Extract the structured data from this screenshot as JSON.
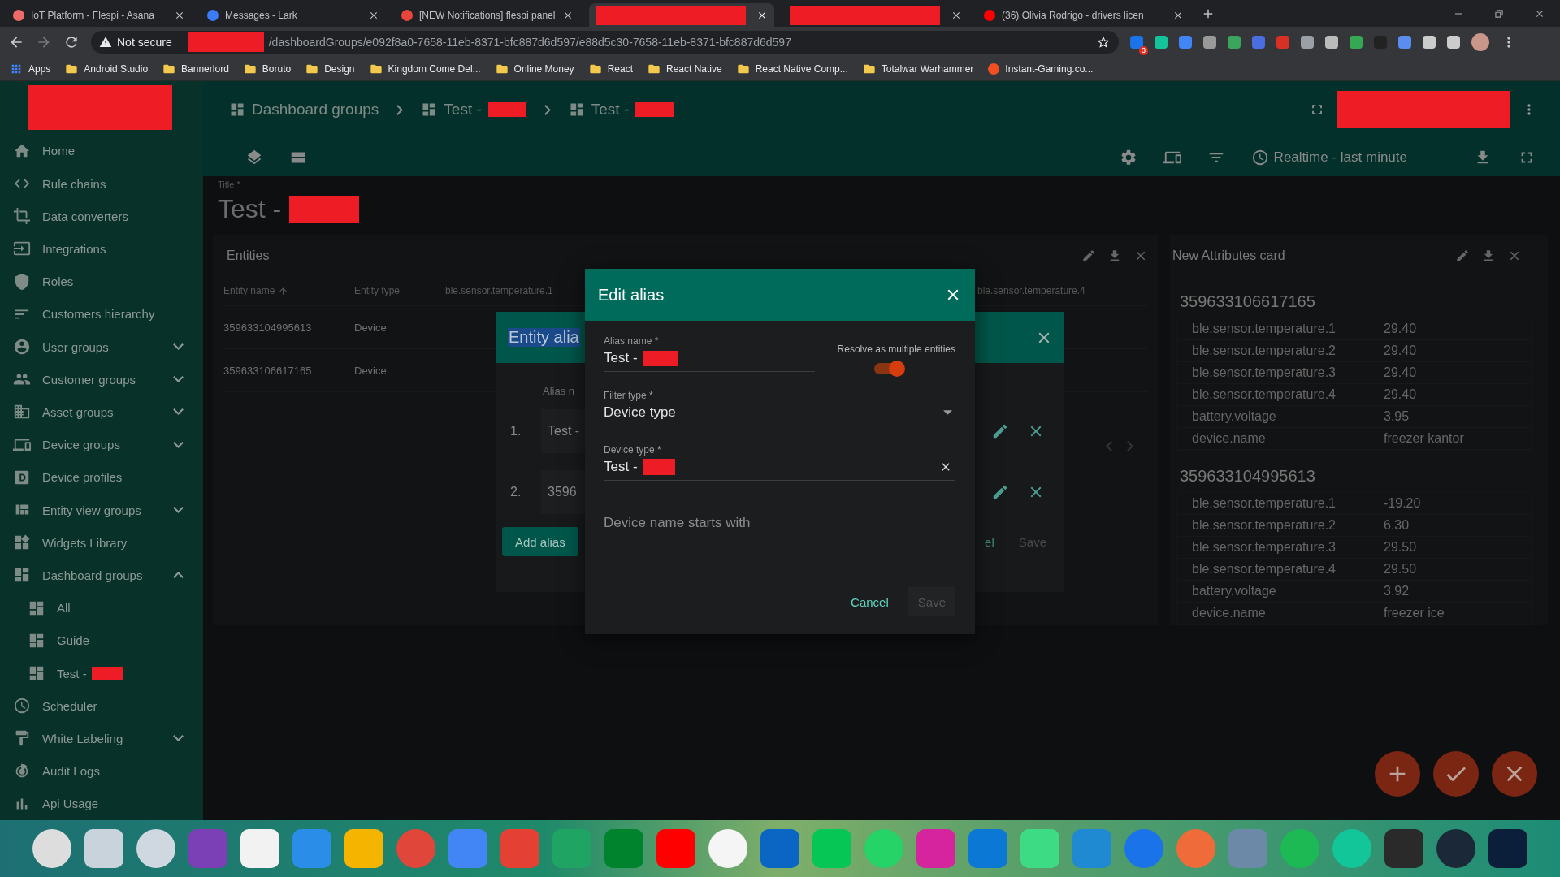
{
  "browser": {
    "tabs": [
      {
        "title": "IoT Platform - Flespi - Asana",
        "selected": false,
        "redacted": false
      },
      {
        "title": "Messages - Lark",
        "selected": false,
        "redacted": false
      },
      {
        "title": "[NEW Notifications] flespi panel",
        "selected": false,
        "redacted": false
      },
      {
        "selected": true,
        "redacted": true
      },
      {
        "selected": false,
        "redacted": true
      },
      {
        "title": "(36) Olivia Rodrigo - drivers licen",
        "selected": false,
        "redacted": false
      }
    ],
    "security": "Not secure",
    "url_redacted": true,
    "url": "/dashboardGroups/e092f8a0-7658-11eb-8371-bfc887d6d597/e88d5c30-7658-11eb-8371-bfc887d6d597",
    "extension_badge": "3",
    "bookmarks": [
      {
        "label": "Apps",
        "kind": "apps"
      },
      {
        "label": "Android Studio",
        "kind": "folder"
      },
      {
        "label": "Bannerlord",
        "kind": "folder"
      },
      {
        "label": "Boruto",
        "kind": "folder"
      },
      {
        "label": "Design",
        "kind": "folder"
      },
      {
        "label": "Kingdom Come Del...",
        "kind": "folder"
      },
      {
        "label": "Online Money",
        "kind": "folder"
      },
      {
        "label": "React",
        "kind": "folder"
      },
      {
        "label": "React Native",
        "kind": "folder"
      },
      {
        "label": "React Native Comp...",
        "kind": "folder"
      },
      {
        "label": "Totalwar Warhammer",
        "kind": "folder"
      },
      {
        "label": "Instant-Gaming.co...",
        "kind": "site"
      }
    ]
  },
  "app": {
    "logo": {
      "redacted": true
    },
    "sidebar": {
      "items": [
        {
          "label": "Home",
          "kind": "link"
        },
        {
          "label": "Rule chains",
          "kind": "link"
        },
        {
          "label": "Data converters",
          "kind": "link"
        },
        {
          "label": "Integrations",
          "kind": "link"
        },
        {
          "label": "Roles",
          "kind": "link"
        },
        {
          "label": "Customers hierarchy",
          "kind": "link"
        },
        {
          "label": "User groups",
          "kind": "group",
          "expanded": false
        },
        {
          "label": "Customer groups",
          "kind": "group",
          "expanded": false
        },
        {
          "label": "Asset groups",
          "kind": "group",
          "expanded": false
        },
        {
          "label": "Device groups",
          "kind": "group",
          "expanded": false
        },
        {
          "label": "Device profiles",
          "kind": "link"
        },
        {
          "label": "Entity view groups",
          "kind": "group",
          "expanded": false
        },
        {
          "label": "Widgets Library",
          "kind": "link"
        },
        {
          "label": "Dashboard groups",
          "kind": "group",
          "expanded": true,
          "children": [
            {
              "label": "All",
              "redacted": false
            },
            {
              "label": "Guide",
              "redacted": false
            },
            {
              "label": "Test -",
              "redacted": true
            }
          ]
        },
        {
          "label": "Scheduler",
          "kind": "link"
        },
        {
          "label": "White Labeling",
          "kind": "group",
          "expanded": false
        },
        {
          "label": "Audit Logs",
          "kind": "link"
        },
        {
          "label": "Api Usage",
          "kind": "link"
        }
      ]
    },
    "breadcrumbs": [
      {
        "label": "Dashboard groups",
        "redacted": false
      },
      {
        "label": "Test -",
        "redacted": true
      },
      {
        "label": "Test -",
        "redacted": true
      }
    ],
    "user": {
      "redacted": true
    },
    "timewindow": "Realtime - last minute",
    "title": {
      "label": "Title *",
      "value": "Test -",
      "redacted": true
    },
    "entities_widget": {
      "title": "Entities",
      "columns": [
        {
          "label": "Entity name",
          "sorted": true
        },
        {
          "label": "Entity type",
          "sorted": false
        },
        {
          "label": "ble.sensor.temperature.1",
          "sorted": false
        },
        {
          "label": "ble.sensor.temperature.4",
          "sorted": false
        }
      ],
      "rows": [
        [
          "359633104995613",
          "Device"
        ],
        [
          "359633106617165",
          "Device"
        ]
      ]
    },
    "attributes_widget": {
      "title": "New Attributes card",
      "entities": [
        {
          "name": "359633106617165",
          "attributes": [
            [
              "ble.sensor.temperature.1",
              "29.40"
            ],
            [
              "ble.sensor.temperature.2",
              "29.40"
            ],
            [
              "ble.sensor.temperature.3",
              "29.40"
            ],
            [
              "ble.sensor.temperature.4",
              "29.40"
            ],
            [
              "battery.voltage",
              "3.95"
            ],
            [
              "device.name",
              "freezer kantor"
            ]
          ]
        },
        {
          "name": "359633104995613",
          "attributes": [
            [
              "ble.sensor.temperature.1",
              "-19.20"
            ],
            [
              "ble.sensor.temperature.2",
              "6.30"
            ],
            [
              "ble.sensor.temperature.3",
              "29.50"
            ],
            [
              "ble.sensor.temperature.4",
              "29.50"
            ],
            [
              "battery.voltage",
              "3.92"
            ],
            [
              "device.name",
              "freezer ice"
            ]
          ]
        }
      ]
    },
    "aliases_dialog": {
      "title": "Entity alia",
      "title_highlighted": true,
      "column_header": "Alias n",
      "rows": [
        {
          "index": "1.",
          "name": "Test -"
        },
        {
          "index": "2.",
          "name": "3596"
        }
      ],
      "add_button": "Add alias",
      "cancel_button": "el",
      "save_button": {
        "label": "Save",
        "disabled": true
      }
    },
    "edit_alias_dialog": {
      "title": "Edit alias",
      "alias_name": {
        "label": "Alias name *",
        "value": "Test -",
        "redacted": true
      },
      "resolve_multiple": {
        "label": "Resolve as multiple entities",
        "on": true
      },
      "filter_type": {
        "label": "Filter type *",
        "value": "Device type"
      },
      "device_type": {
        "label": "Device type *",
        "value": "Test -",
        "redacted": true
      },
      "name_filter": {
        "placeholder": "Device name starts with"
      },
      "cancel_button": "Cancel",
      "save_button": {
        "label": "Save",
        "disabled": true
      }
    }
  }
}
